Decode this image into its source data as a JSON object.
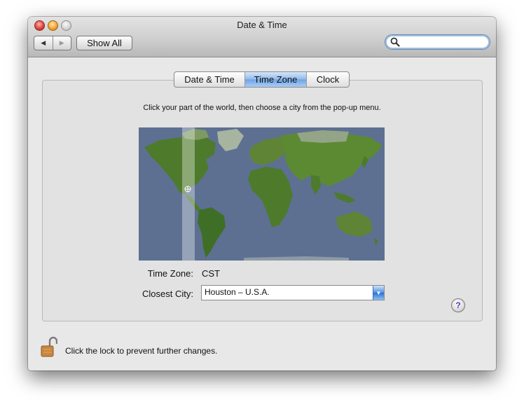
{
  "window": {
    "title": "Date & Time"
  },
  "toolbar": {
    "back_icon": "back-arrow-icon",
    "forward_icon": "forward-arrow-icon",
    "show_all_label": "Show All"
  },
  "search": {
    "value": "",
    "icon": "magnifier-icon"
  },
  "tabs": [
    {
      "label": "Date & Time",
      "selected": false
    },
    {
      "label": "Time Zone",
      "selected": true
    },
    {
      "label": "Clock",
      "selected": false
    }
  ],
  "time_zone": {
    "instructions": "Click your part of the world, then choose a city from the pop-up menu.",
    "time_zone_label": "Time Zone:",
    "time_zone_value": "CST",
    "closest_city_label": "Closest City:",
    "closest_city_value": "Houston – U.S.A."
  },
  "help": {
    "label": "?"
  },
  "lock": {
    "text": "Click the lock to prevent further changes.",
    "state": "unlocked"
  },
  "colors": {
    "ocean": "#5d7092",
    "land": "#4e7a2c",
    "accent": "#3f7fdc"
  }
}
